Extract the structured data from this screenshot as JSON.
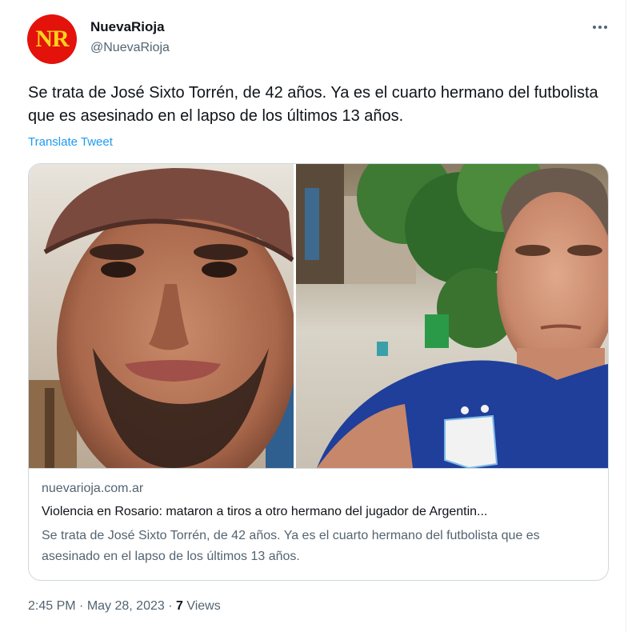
{
  "author": {
    "avatar_text": "NR",
    "display_name": "NuevaRioja",
    "handle": "@NuevaRioja"
  },
  "tweet": {
    "text": "Se trata de José Sixto Torrén, de 42 años. Ya es el cuarto hermano del futbolista que es asesinado en el lapso de los últimos 13 años.",
    "translate_label": "Translate Tweet"
  },
  "card": {
    "domain": "nuevarioja.com.ar",
    "title": "Violencia en Rosario: mataron a tiros a otro hermano del jugador de Argentin...",
    "description": "Se trata de José Sixto Torrén, de 42 años. Ya es el cuarto hermano del futbolista que es asesinado en el lapso de los últimos 13 años."
  },
  "meta": {
    "time": "2:45 PM",
    "separator": " · ",
    "date": "May 28, 2023",
    "views_count": "7",
    "views_label": "Views"
  },
  "colors": {
    "brand_red": "#e3120b",
    "brand_yellow": "#ffd21a",
    "link_blue": "#1d9bf0",
    "secondary_text": "#536471"
  },
  "icons": {
    "more": "more-horizontal-icon"
  }
}
